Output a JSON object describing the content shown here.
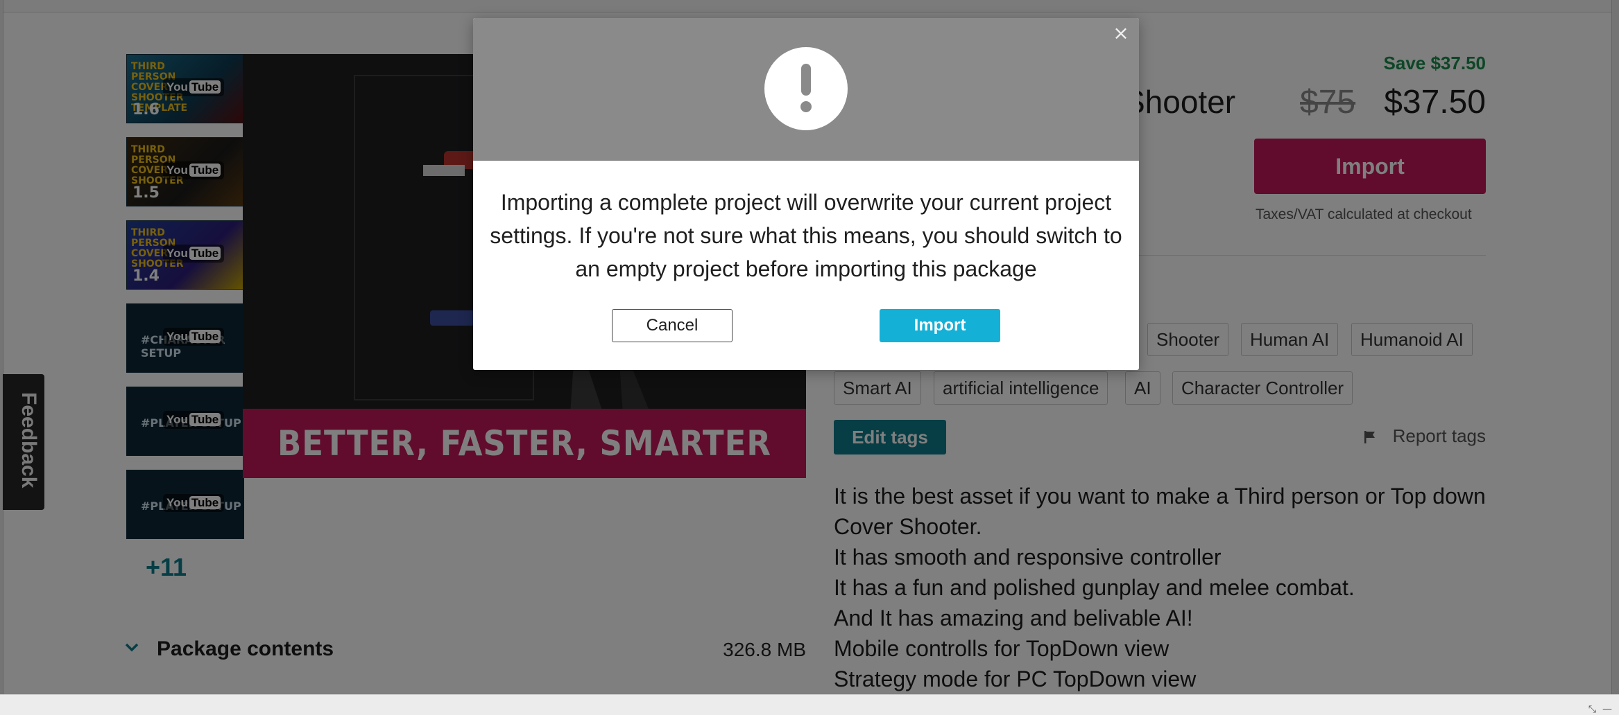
{
  "thumbnails": [
    {
      "caption": "THIRD PERSON COVER SHOOTER TEMPLATE",
      "number": "1.6",
      "youtube_you": "You",
      "youtube_tube": "Tube"
    },
    {
      "caption": "THIRD PERSON COVER SHOOTER",
      "number": "1.5",
      "youtube_you": "You",
      "youtube_tube": "Tube"
    },
    {
      "caption": "THIRD PERSON COVER SHOOTER",
      "number": "1.4",
      "youtube_you": "You",
      "youtube_tube": "Tube"
    },
    {
      "caption": "#CHARACTER SETUP",
      "number": "",
      "youtube_you": "You",
      "youtube_tube": "Tube"
    },
    {
      "caption": "#PLAYER SETUP",
      "number": "",
      "youtube_you": "You",
      "youtube_tube": "Tube"
    },
    {
      "caption": "#PLAYER SETUP",
      "number": "",
      "youtube_you": "You",
      "youtube_tube": "Tube"
    }
  ],
  "more_count": "+11",
  "hero": {
    "banner_text": "BETTER, FASTER, SMARTER"
  },
  "package": {
    "label": "Package contents",
    "size": "326.8 MB"
  },
  "product": {
    "title_visible": "Shooter",
    "save": "Save $37.50",
    "old_price": "$75",
    "price": "$37.50",
    "buy_label": "Import",
    "tax_note": "Taxes/VAT calculated at checkout"
  },
  "tags": {
    "row1": [
      "Shooter",
      "Human AI",
      "Humanoid AI"
    ],
    "row2": [
      "Smart AI",
      "artificial intelligence",
      "AI",
      "Character Controller"
    ],
    "edit_label": "Edit tags",
    "report_label": "Report tags"
  },
  "description": [
    "It is the best asset if you want to make a Third person or Top down Cover Shooter.",
    "It has smooth and responsive controller",
    "It has a fun and polished gunplay and melee combat.",
    "And It has amazing and belivable AI!",
    "Mobile controlls for TopDown view",
    "Strategy mode for PC TopDown view"
  ],
  "feedback_label": "Feedback",
  "modal": {
    "close_glyph": "×",
    "message": "Importing a complete project will overwrite your current project settings. If you're not sure what this means, you should switch to an empty project before importing this package",
    "cancel_label": "Cancel",
    "import_label": "Import"
  },
  "colors": {
    "accent_pink": "#c2185b",
    "accent_teal": "#0f7c8c",
    "import_blue": "#15b0d6",
    "save_green": "#1a8c4e"
  }
}
